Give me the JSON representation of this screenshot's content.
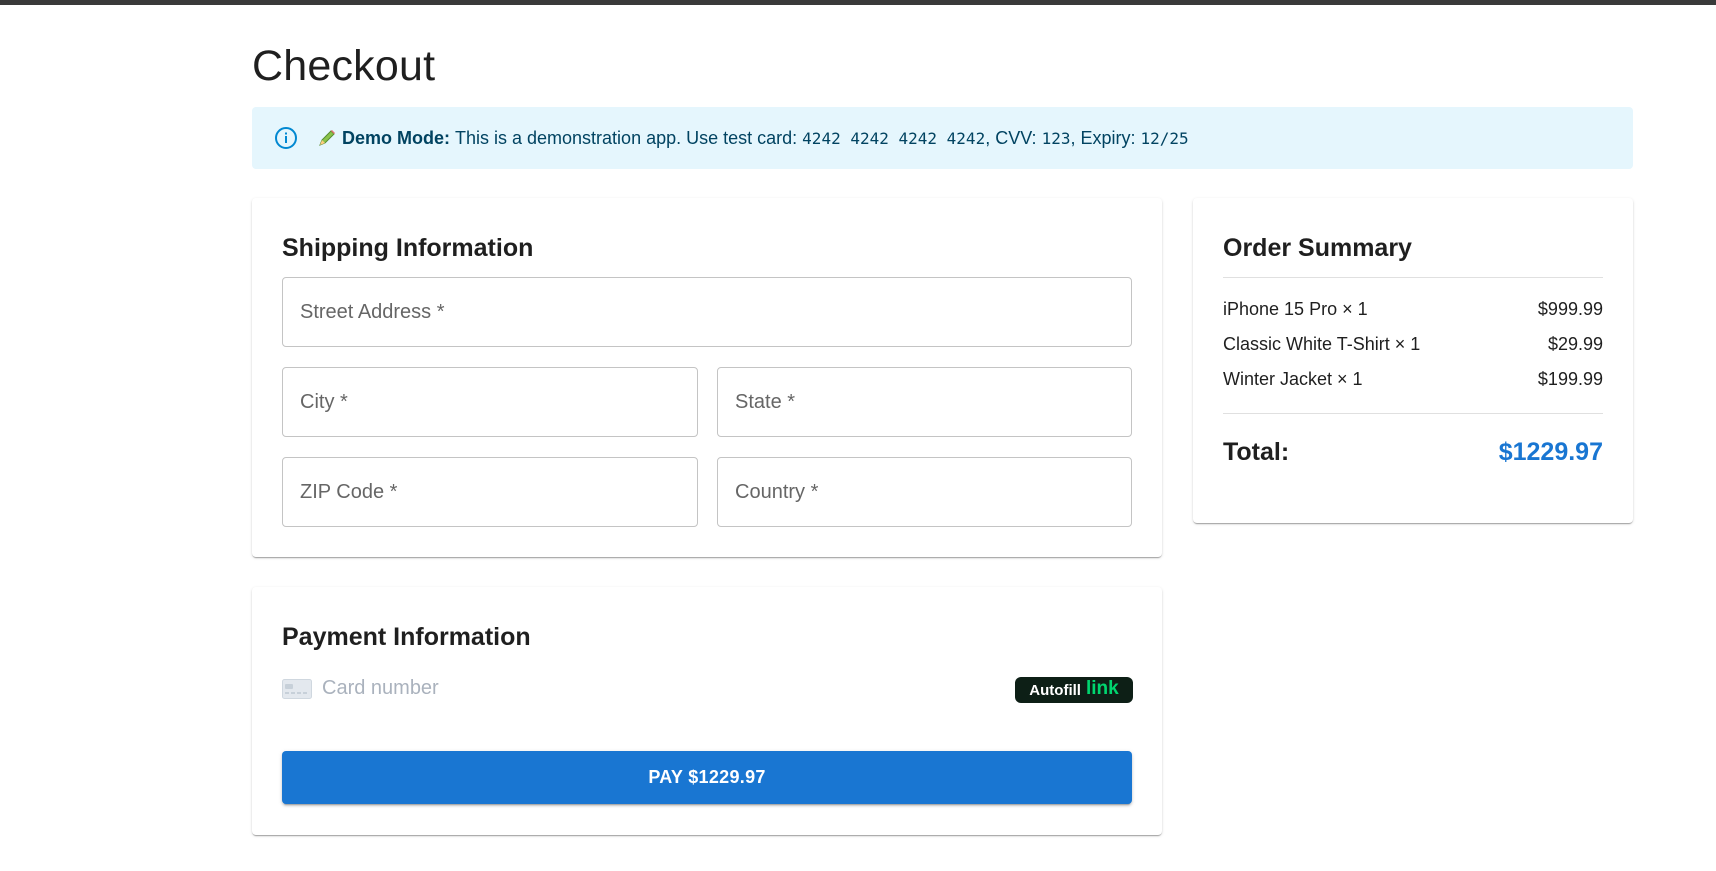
{
  "page": {
    "title": "Checkout"
  },
  "alert": {
    "icon": "info-icon",
    "emoji": "pencil-icon",
    "bold_label": "Demo Mode:",
    "text_before": "This is a demonstration app. Use test card: ",
    "card": "4242 4242 4242 4242",
    "cvv_label": ", CVV: ",
    "cvv": "123",
    "expiry_label": ", Expiry: ",
    "expiry": "12/25",
    "background": "#e5f6fd",
    "color": "#014361"
  },
  "shipping": {
    "title": "Shipping Information",
    "fields": {
      "street": "Street Address *",
      "city": "City *",
      "state": "State *",
      "zip": "ZIP Code *",
      "country": "Country *"
    }
  },
  "payment": {
    "title": "Payment Information",
    "card_placeholder": "Card number",
    "card_icon": "credit-card-icon",
    "autofill_label": "Autofill",
    "autofill_link": "link",
    "pay_button": "PAY $1229.97"
  },
  "summary": {
    "title": "Order Summary",
    "items": [
      {
        "name": "iPhone 15 Pro × 1",
        "price": "$999.99"
      },
      {
        "name": "Classic White T-Shirt × 1",
        "price": "$29.99"
      },
      {
        "name": "Winter Jacket × 1",
        "price": "$199.99"
      }
    ],
    "total_label": "Total:",
    "total_value": "$1229.97"
  },
  "colors": {
    "accent": "#1976d2",
    "link_green": "#00d66f",
    "link_bg": "#0d1f16"
  }
}
